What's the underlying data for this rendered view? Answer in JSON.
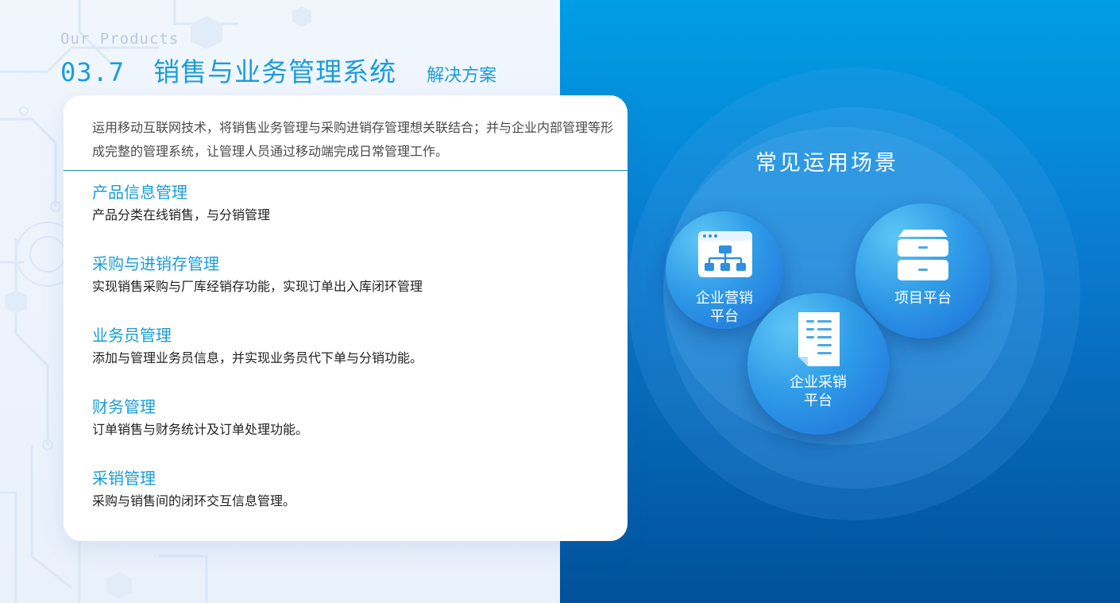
{
  "header": {
    "eyebrow": "Our Products",
    "number": "03.7",
    "title": "销售与业务管理系统",
    "subtitle": "解决方案"
  },
  "card": {
    "intro": "运用移动互联网技术，将销售业务管理与采购进销存管理想关联结合；并与企业内部管理等形成完整的管理系统，让管理人员通过移动端完成日常管理工作。",
    "features": [
      {
        "title": "产品信息管理",
        "desc": "产品分类在线销售，与分销管理"
      },
      {
        "title": "采购与进销存管理",
        "desc": "实现销售采购与厂库经销存功能，实现订单出入库闭环管理"
      },
      {
        "title": "业务员管理",
        "desc": "添加与管理业务员信息，并实现业务员代下单与分销功能。"
      },
      {
        "title": "财务管理",
        "desc": "订单销售与财务统计及订单处理功能。"
      },
      {
        "title": "采销管理",
        "desc": "采购与销售间的闭环交互信息管理。"
      }
    ]
  },
  "scenarios": {
    "title": "常见运用场景",
    "items": [
      {
        "line1": "企业营销",
        "line2": "平台",
        "icon": "org-chart-icon"
      },
      {
        "line1": "项目平台",
        "line2": "",
        "icon": "cabinet-icon"
      },
      {
        "line1": "企业采销",
        "line2": "平台",
        "icon": "document-icon"
      }
    ]
  },
  "colors": {
    "accent": "#1a9dd9",
    "panel_top": "#009ee4",
    "panel_bottom": "#00519a",
    "divider": "#1d8aa8"
  }
}
